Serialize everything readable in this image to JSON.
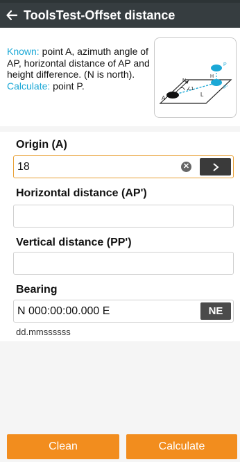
{
  "appbar": {
    "title": "ToolsTest-Offset distance",
    "back_icon": "arrow-left-icon"
  },
  "info": {
    "known_label": "Known:",
    "known_text": " point A, azimuth angle of AP, horizontal distance of AP and height difference. (N is north).",
    "calc_label": "Calculate:",
    "calc_text": " point P.",
    "diagram": {
      "N": "N",
      "angle": "∠1",
      "H": "H",
      "L": "L",
      "A": "A",
      "P": "P",
      "Pp": "P'"
    }
  },
  "form": {
    "origin": {
      "label": "Origin (A)",
      "value": "18",
      "go_icon": "chevron-right-icon",
      "clear_icon": "close-circle-icon"
    },
    "hdist": {
      "label": "Horizontal distance (AP')",
      "value": ""
    },
    "vdist": {
      "label": "Vertical distance (PP')",
      "value": ""
    },
    "bearing": {
      "label": "Bearing",
      "value": "N 000:00:00.000 E",
      "toggle": "NE",
      "hint": "dd.mmssssss"
    }
  },
  "buttons": {
    "clean": "Clean",
    "calculate": "Calculate"
  },
  "colors": {
    "accent": "#f28d1e",
    "highlight": "#1ba8d6",
    "appbar": "#363d40"
  }
}
